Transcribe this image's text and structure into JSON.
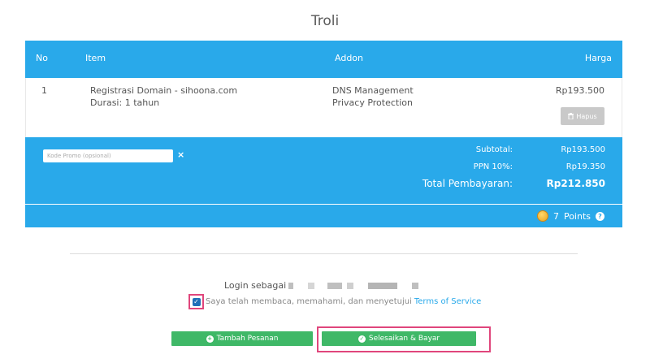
{
  "page": {
    "title": "Troli"
  },
  "cart": {
    "headers": {
      "no": "No",
      "item": "Item",
      "addon": "Addon",
      "price": "Harga"
    },
    "rows": [
      {
        "no": "1",
        "item_name": "Registrasi Domain - sihoona.com",
        "item_duration": "Durasi: 1 tahun",
        "addons": [
          "DNS Management",
          "Privacy Protection"
        ],
        "price": "Rp193.500",
        "delete_label": "Hapus"
      }
    ],
    "promo": {
      "placeholder": "Kode Promo (opsional)",
      "value": "",
      "clear_symbol": "×"
    },
    "summary": {
      "subtotal_label": "Subtotal:",
      "subtotal_value": "Rp193.500",
      "tax_label": "PPN 10%:",
      "tax_value": "Rp19.350",
      "total_label": "Total Pembayaran:",
      "total_value": "Rp212.850"
    },
    "points": {
      "value": "7",
      "label": "Points",
      "help_symbol": "?"
    }
  },
  "login": {
    "label": "Login sebagai"
  },
  "tos": {
    "checked": true,
    "text": "Saya telah membaca, memahami, dan menyetujui",
    "link": "Terms of Service"
  },
  "actions": {
    "add_order": "Tambah Pesanan",
    "checkout": "Selesaikan & Bayar"
  },
  "colors": {
    "primary": "#29a9ea",
    "success": "#3fb867",
    "highlight": "#e0467c"
  }
}
